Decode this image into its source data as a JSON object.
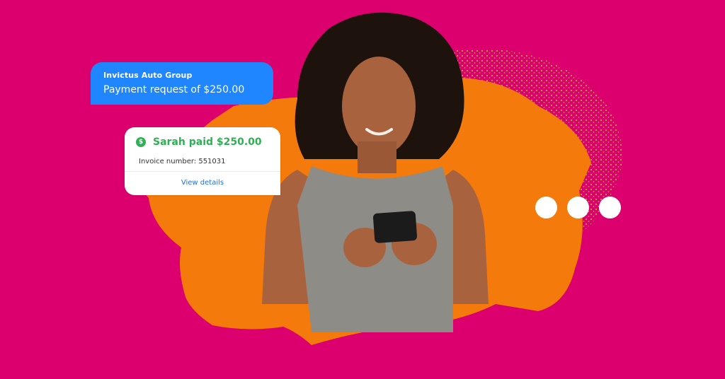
{
  "message": {
    "sender": "Invictus Auto Group",
    "text": "Payment request of $250.00"
  },
  "payment_card": {
    "icon": "dollar-icon",
    "icon_glyph": "$",
    "title": "Sarah paid $250.00",
    "invoice": "Invoice number: 551031",
    "link": "View details"
  },
  "typing_indicator": {
    "dots": 3
  },
  "colors": {
    "background": "#DC006E",
    "accent_orange": "#F47A0C",
    "message_blue": "#1F86FF",
    "paid_green": "#2FB054",
    "link_blue": "#1F6FE0"
  }
}
